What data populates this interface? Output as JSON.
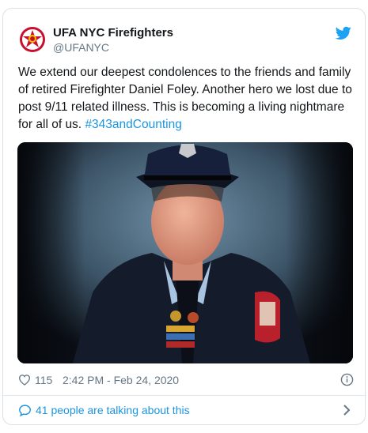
{
  "tweet": {
    "author": {
      "display_name": "UFA NYC Firefighters",
      "handle": "@UFANYC",
      "avatar_icon": "ufa-badge-logo"
    },
    "brand_icon": "twitter-bird-icon",
    "text": "We extend our deepest condolences to the friends and family of retired Firefighter Daniel Foley. Another hero we lost due to post 9/11 related illness. This is becoming a living nightmare for all of us. ",
    "hashtag": "#343andCounting",
    "photo_subject": "firefighter-portrait",
    "likes": "115",
    "timestamp": "2:42 PM - Feb 24, 2020",
    "info_icon": "info-icon",
    "conversation_text": "41 people are talking about this"
  },
  "colors": {
    "text": "#14171a",
    "secondary": "#657786",
    "link": "#1b95e0",
    "border": "#d9e1e6"
  }
}
